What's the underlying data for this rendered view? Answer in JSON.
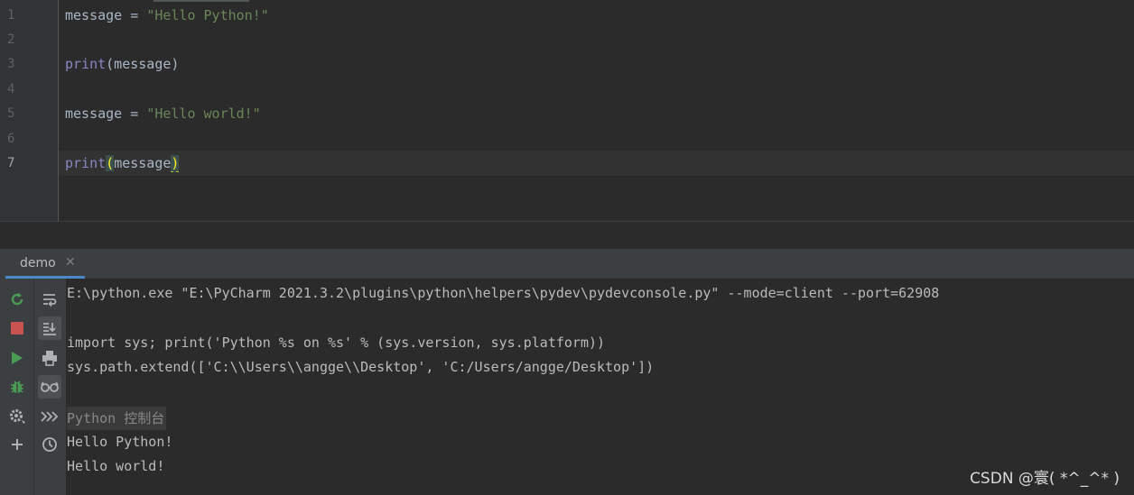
{
  "editor": {
    "line_numbers": [
      "1",
      "2",
      "3",
      "4",
      "5",
      "6",
      "7"
    ],
    "code": {
      "l1_var": "message",
      "l1_op": " = ",
      "l1_str": "\"Hello Python!\"",
      "l3_fn": "print",
      "l3_args": "(message)",
      "l5_var": "message",
      "l5_op": " = ",
      "l5_str": "\"Hello world!\"",
      "l7_fn": "print",
      "l7_open": "(",
      "l7_arg": "message",
      "l7_close": ")"
    }
  },
  "run_panel": {
    "tab_label": "demo",
    "tab_close": "✕",
    "console": {
      "command": "E:\\python.exe \"E:\\PyCharm 2021.3.2\\plugins\\python\\helpers\\pydev\\pydevconsole.py\" --mode=client --port=62908",
      "import_line": "import sys; print('Python %s on %s' % (sys.version, sys.platform))",
      "path_line": "sys.path.extend(['C:\\\\Users\\\\angge\\\\Desktop', 'C:/Users/angge/Desktop'])",
      "prompt_label": "Python 控制台",
      "output": [
        "Hello Python!",
        "Hello world!"
      ]
    },
    "toolbar_left": [
      "rerun-icon",
      "stop-icon",
      "run-icon",
      "debug-icon",
      "settings-icon",
      "add-icon"
    ],
    "toolbar_right": [
      "soft-wrap-icon",
      "scroll-to-end-icon",
      "print-icon",
      "show-variables-icon",
      "execute-icon",
      "history-icon"
    ]
  },
  "watermark": "CSDN @寰( *^_^* )",
  "colors": {
    "background": "#2b2b2b",
    "gutter": "#313335",
    "string": "#6a8759",
    "builtin": "#8888c6",
    "run_green": "#499c54",
    "stop_red": "#c75450",
    "tab_underline": "#4a88c7"
  }
}
